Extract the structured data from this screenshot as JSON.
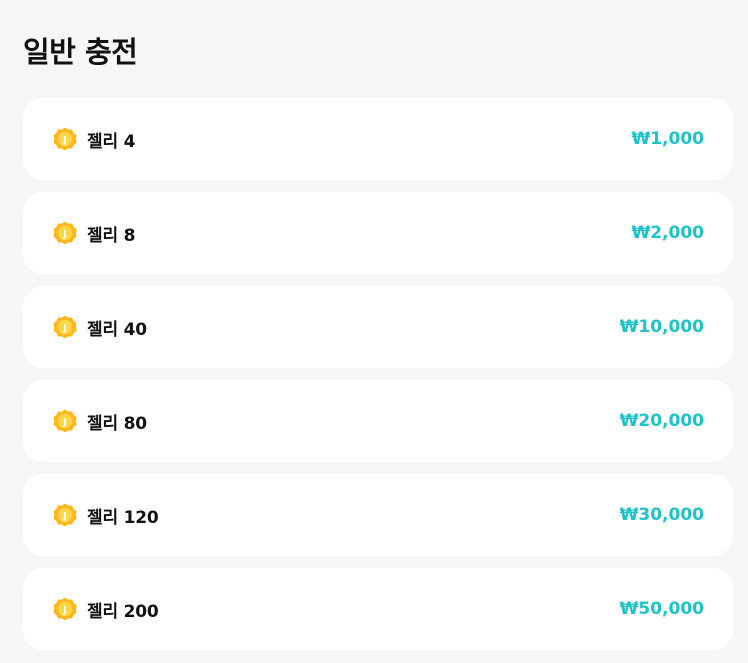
{
  "section": {
    "title": "일반 충전"
  },
  "colors": {
    "price": "#1ec3c8",
    "coin": "#ffb81c",
    "background": "#f6f6f8"
  },
  "icon": "jelly-coin-icon",
  "products": [
    {
      "label": "젤리 4",
      "price": "₩1,000"
    },
    {
      "label": "젤리 8",
      "price": "₩2,000"
    },
    {
      "label": "젤리 40",
      "price": "₩10,000"
    },
    {
      "label": "젤리 80",
      "price": "₩20,000"
    },
    {
      "label": "젤리 120",
      "price": "₩30,000"
    },
    {
      "label": "젤리 200",
      "price": "₩50,000"
    }
  ]
}
